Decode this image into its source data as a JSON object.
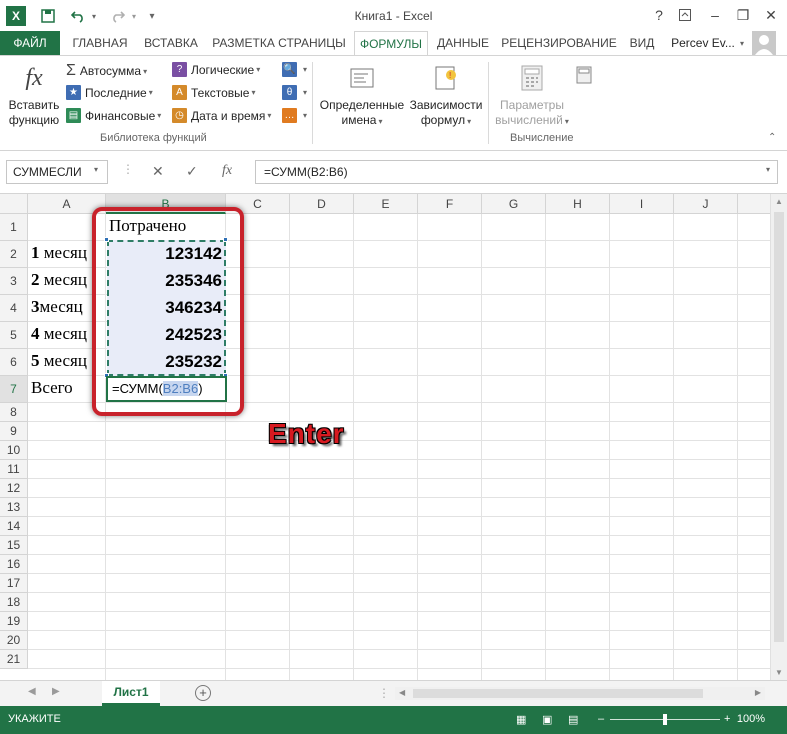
{
  "window": {
    "title": "Книга1 - Excel",
    "minimize": "–",
    "restore": "❐",
    "close": "✕",
    "help": "?"
  },
  "qat": {
    "app_icon": "X",
    "save_icon": "save-icon",
    "undo_icon": "undo-icon",
    "redo_icon": "redo-icon"
  },
  "tabs": [
    {
      "label": "ФАЙЛ"
    },
    {
      "label": "ГЛАВНАЯ"
    },
    {
      "label": "ВСТАВКА"
    },
    {
      "label": "РАЗМЕТКА СТРАНИЦЫ"
    },
    {
      "label": "ФОРМУЛЫ"
    },
    {
      "label": "ДАННЫЕ"
    },
    {
      "label": "РЕЦЕНЗИРОВАНИЕ"
    },
    {
      "label": "ВИД"
    }
  ],
  "user": {
    "name": "Percev Ev..."
  },
  "ribbon": {
    "insert_function": {
      "line1": "Вставить",
      "line2": "функцию",
      "glyph": "fx"
    },
    "autosum": "Автосумма",
    "recent": "Последние",
    "financial": "Финансовые",
    "logical": "Логические",
    "text": "Текстовые",
    "datetime": "Дата и время",
    "library_label": "Библиотека функций",
    "defined_names": {
      "line1": "Определенные",
      "line2": "имена"
    },
    "dependencies": {
      "line1": "Зависимости",
      "line2": "формул"
    },
    "calc_options": {
      "line1": "Параметры",
      "line2": "вычислений"
    },
    "calc_label": "Вычисление"
  },
  "formula_bar": {
    "name_box": "СУММЕСЛИ",
    "cancel": "✕",
    "enter": "✓",
    "fx": "fx",
    "formula": "=СУММ(B2:B6)"
  },
  "columns": [
    "A",
    "B",
    "C",
    "D",
    "E",
    "F",
    "G",
    "H",
    "I",
    "J"
  ],
  "rows": [
    "1",
    "2",
    "3",
    "4",
    "5",
    "6",
    "7",
    "8",
    "9",
    "10",
    "11",
    "12",
    "13",
    "14",
    "15",
    "16",
    "17",
    "18",
    "19",
    "20",
    "21"
  ],
  "cells": {
    "B1": "Потрачено",
    "months": [
      {
        "n": "1",
        "label": " месяц"
      },
      {
        "n": "2",
        "label": " месяц"
      },
      {
        "n": "3",
        "label": "месяц"
      },
      {
        "n": "4",
        "label": " месяц"
      },
      {
        "n": "5",
        "label": " месяц"
      }
    ],
    "values": [
      "123142",
      "235346",
      "346234",
      "242523",
      "235232"
    ],
    "A7": "Всего",
    "B7_prefix": "=СУММ(",
    "B7_ref": "B2:B6",
    "B7_suffix": ")"
  },
  "annotation": {
    "text": "Enter"
  },
  "sheets": {
    "active": "Лист1",
    "add": "+"
  },
  "status": {
    "mode": "УКАЖИТЕ",
    "zoom": "100%"
  },
  "colors": {
    "accent": "#217346",
    "highlight": "#c8222b",
    "selection_fill": "#e8ecf8"
  }
}
